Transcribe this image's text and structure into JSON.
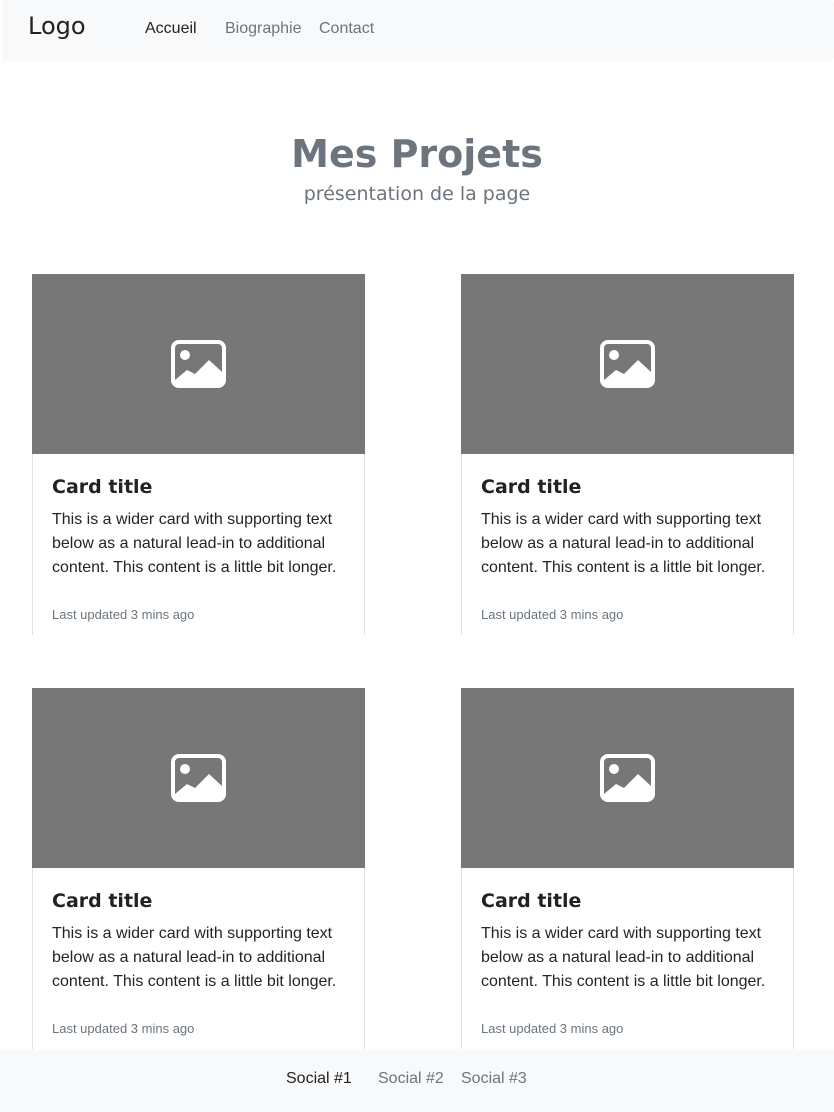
{
  "navbar": {
    "logo": "Logo",
    "links": [
      "Accueil",
      "Biographie",
      "Contact"
    ]
  },
  "hero": {
    "title": "Mes Projets",
    "subtitle": "présentation de la page"
  },
  "cards": [
    {
      "title": "Card title",
      "text": "This is a wider card with supporting text below as a natural lead-in to additional content. This content is a little bit longer.",
      "updated": "Last updated 3 mins ago",
      "image_icon": "image-placeholder-icon"
    },
    {
      "title": "Card title",
      "text": "This is a wider card with supporting text below as a natural lead-in to additional content. This content is a little bit longer.",
      "updated": "Last updated 3 mins ago",
      "image_icon": "image-placeholder-icon"
    },
    {
      "title": "Card title",
      "text": "This is a wider card with supporting text below as a natural lead-in to additional content. This content is a little bit longer.",
      "updated": "Last updated 3 mins ago",
      "image_icon": "image-placeholder-icon"
    },
    {
      "title": "Card title",
      "text": "This is a wider card with supporting text below as a natural lead-in to additional content. This content is a little bit longer.",
      "updated": "Last updated 3 mins ago",
      "image_icon": "image-placeholder-icon"
    }
  ],
  "footer": {
    "links": [
      "Social #1",
      "Social #2",
      "Social #3"
    ]
  },
  "colors": {
    "navbar_bg": "#f8f9fa",
    "image_placeholder": "#777777",
    "muted_text": "#6c757d",
    "active_text": "#222222"
  }
}
